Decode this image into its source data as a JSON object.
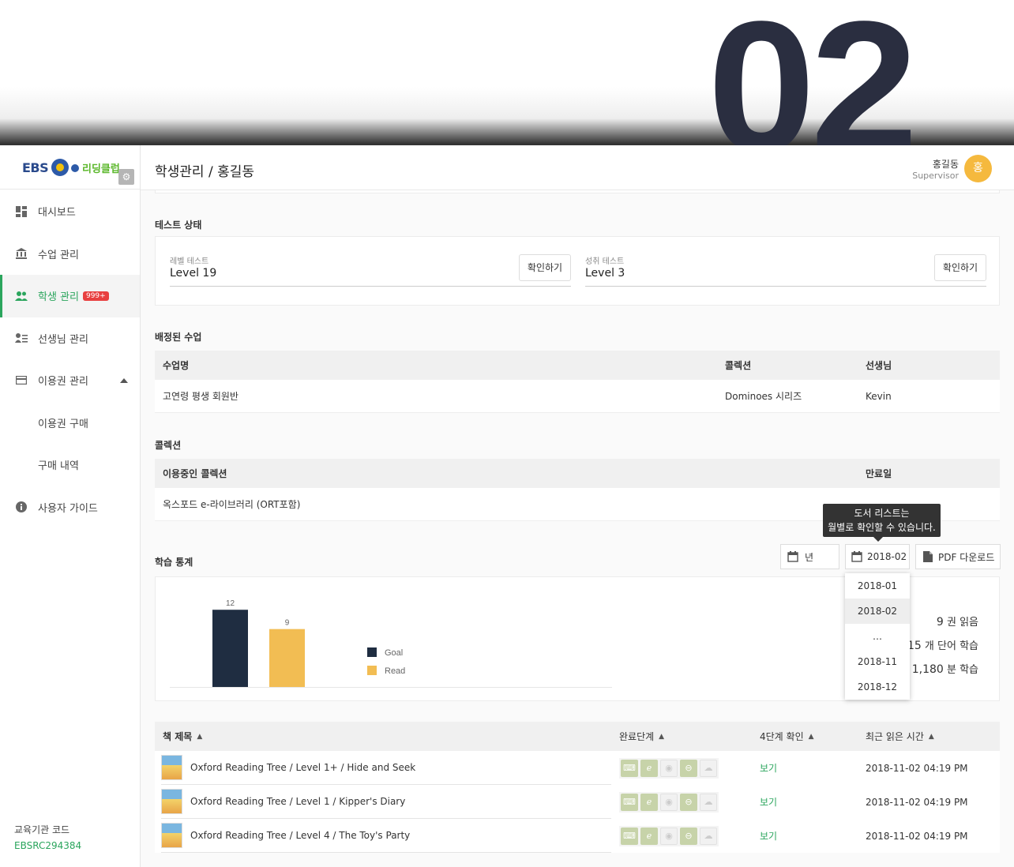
{
  "hero": {
    "number": "02"
  },
  "logo": {
    "ebs": "EBS",
    "club": "리딩클럽",
    "gear": "⚙"
  },
  "sidebar": {
    "items": [
      {
        "label": "대시보드",
        "icon": "dashboard-icon"
      },
      {
        "label": "수업 관리",
        "icon": "bank-icon"
      },
      {
        "label": "학생 관리",
        "icon": "people-icon",
        "badge": "999+",
        "active": true
      },
      {
        "label": "선생님 관리",
        "icon": "teacher-list-icon"
      },
      {
        "label": "이용권 관리",
        "icon": "card-icon",
        "expanded": true
      },
      {
        "label": "이용권 구매",
        "sub": true
      },
      {
        "label": "구매 내역",
        "sub": true
      },
      {
        "label": "사용자 가이드",
        "icon": "info-icon"
      }
    ],
    "org_code_label": "교육기관 코드",
    "org_code": "EBSRC294384"
  },
  "topbar": {
    "title": "학생관리 / 홍길동",
    "user_name": "홍길동",
    "user_role": "Supervisor",
    "avatar": "홍"
  },
  "test_status": {
    "title": "테스트 상태",
    "level": {
      "label": "레벨 테스트",
      "value": "Level 19",
      "button": "확인하기"
    },
    "achieve": {
      "label": "성취 테스트",
      "value": "Level 3",
      "button": "확인하기"
    }
  },
  "classes": {
    "title": "배정된 수업",
    "headers": [
      "수업명",
      "콜렉션",
      "선생님"
    ],
    "rows": [
      [
        "고연령 평생 회원반",
        "Dominoes 시리즈",
        "Kevin"
      ]
    ]
  },
  "collection": {
    "title": "콜렉션",
    "headers": [
      "이용중인 콜렉션",
      "만료일"
    ],
    "rows": [
      [
        "옥스포드 e-라이브러리 (ORT포함)",
        ""
      ]
    ]
  },
  "stats": {
    "title": "학습 통계",
    "year_button": "년",
    "month_button": "2018-02",
    "pdf_button": "PDF 다운로드",
    "tooltip_line1": "도서 리스트는",
    "tooltip_line2": "월별로 확인할 수 있습니다.",
    "menu": [
      "2018-01",
      "2018-02",
      "…",
      "2018-11",
      "2018-12"
    ],
    "menu_selected": 1,
    "summary": [
      {
        "value": "9",
        "unit": "권 읽음"
      },
      {
        "value": "415",
        "unit": "개 단어 학습"
      },
      {
        "value": "1,180",
        "unit": "분 학습"
      }
    ]
  },
  "chart_data": {
    "type": "bar",
    "categories": [
      "Goal",
      "Read"
    ],
    "values": [
      12,
      9
    ],
    "colors": [
      "#1f2d41",
      "#f2bd53"
    ],
    "legend": [
      "Goal",
      "Read"
    ],
    "legend_position": "right",
    "ylim": [
      0,
      13.5
    ]
  },
  "books": {
    "headers": [
      "책 제목",
      "완료단계",
      "4단계 확인",
      "최근 읽은 시간"
    ],
    "rows": [
      {
        "title": "Oxford Reading Tree / Level 1+ / Hide and Seek",
        "stages": [
          true,
          true,
          false,
          true,
          false
        ],
        "link": "보기",
        "time": "2018-11-02 04:19 PM"
      },
      {
        "title": "Oxford Reading Tree / Level 1 / Kipper's Diary",
        "stages": [
          true,
          true,
          false,
          true,
          false
        ],
        "link": "보기",
        "time": "2018-11-02 04:19 PM"
      },
      {
        "title": "Oxford Reading Tree / Level 4 / The Toy's Party",
        "stages": [
          true,
          true,
          false,
          true,
          false
        ],
        "link": "보기",
        "time": "2018-11-02 04:19 PM"
      }
    ],
    "stage_icons": [
      "gamepad-icon",
      "ear-icon",
      "eye-icon",
      "mouth-icon",
      "speech-icon"
    ]
  },
  "colors": {
    "accent": "#2ba55d",
    "badge": "#e84040",
    "avatar": "#f5b93e",
    "goal": "#1f2d41",
    "read": "#f2bd53"
  }
}
